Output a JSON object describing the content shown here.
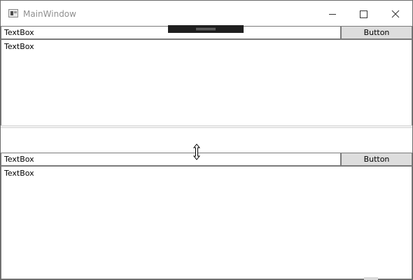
{
  "window": {
    "title": "MainWindow",
    "controls": {
      "minimize_icon": "minimize-icon",
      "maximize_icon": "maximize-icon",
      "close_icon": "close-icon"
    }
  },
  "top_panel": {
    "textbox_label": "TextBox",
    "button_label": "Button",
    "area_text": "TextBox"
  },
  "bottom_panel": {
    "textbox_label": "TextBox",
    "button_label": "Button",
    "area_text": "TextBox"
  },
  "colors": {
    "title_text": "#8f8f8f",
    "button_bg": "#dddddd",
    "border": "#7a7a7a",
    "debug_toolbar": "#1f1f1f"
  }
}
